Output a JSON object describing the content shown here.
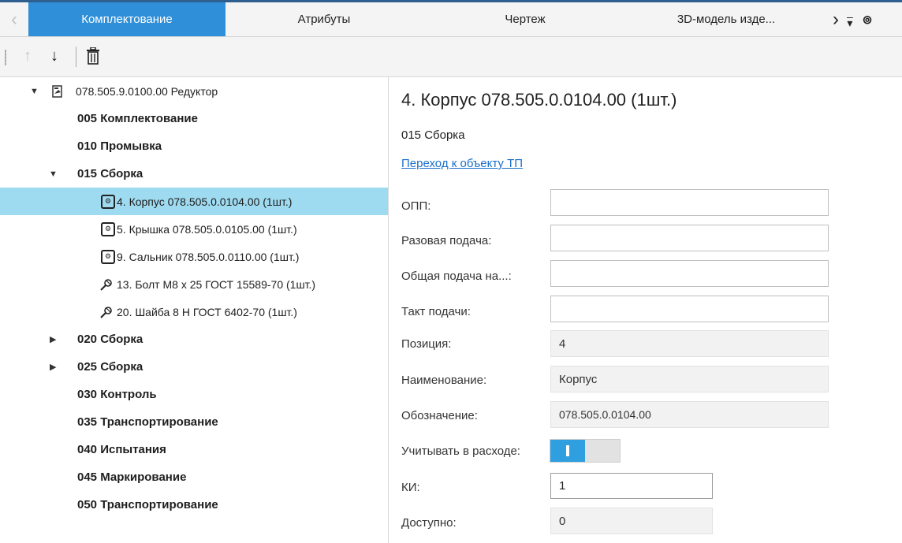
{
  "tabs": {
    "items": [
      {
        "label": "Комплектование",
        "active": true
      },
      {
        "label": "Атрибуты",
        "active": false
      },
      {
        "label": "Чертеж",
        "active": false
      },
      {
        "label": "3D-модель изде...",
        "active": false
      }
    ],
    "prev_icon": "chevron-left-icon",
    "next_icon": "chevron-right-icon",
    "menu_icon": "overflow-menu-icon",
    "accent_color": "#2f8fd8"
  },
  "toolbar": {
    "move_up_icon": "arrow-up-icon",
    "move_down_icon": "arrow-down-icon",
    "delete_icon": "trash-icon"
  },
  "tree": {
    "root": {
      "label": "078.505.9.0100.00 Редуктор",
      "icon": "assembly-icon"
    },
    "op_005": "005 Комплектование",
    "op_010": "010 Промывка",
    "op_015": "015 Сборка",
    "items_015": [
      {
        "label": "4. Корпус 078.505.0.0104.00 (1шт.)",
        "icon": "part-icon",
        "selected": true
      },
      {
        "label": "5. Крышка 078.505.0.0105.00 (1шт.)",
        "icon": "part-icon"
      },
      {
        "label": "9. Сальник 078.505.0.0110.00 (1шт.)",
        "icon": "part-icon"
      },
      {
        "label": "13. Болт М8 х 25 ГОСТ 15589-70 (1шт.)",
        "icon": "standard-part-icon"
      },
      {
        "label": "20. Шайба 8 Н ГОСТ 6402-70 (1шт.)",
        "icon": "standard-part-icon"
      }
    ],
    "op_020": "020 Сборка",
    "op_025": "025 Сборка",
    "op_030": "030 Контроль",
    "op_035": "035 Транспортирование",
    "op_040": "040 Испытания",
    "op_045": "045 Маркирование",
    "op_050": "050 Транспортирование",
    "selected_color": "#9edaf0"
  },
  "detail": {
    "title": "4. Корпус 078.505.0.0104.00 (1шт.)",
    "operation": "015 Сборка",
    "link": "Переход к объекту ТП",
    "fields": {
      "opp": {
        "label": "ОПП:",
        "value": ""
      },
      "single_feed": {
        "label": "Разовая подача:",
        "value": ""
      },
      "total_feed": {
        "label": "Общая подача на...:",
        "value": ""
      },
      "feed_tact": {
        "label": "Такт подачи:",
        "value": ""
      },
      "position": {
        "label": "Позиция:",
        "value": "4"
      },
      "name": {
        "label": "Наименование:",
        "value": "Корпус"
      },
      "designation": {
        "label": "Обозначение:",
        "value": "078.505.0.0104.00"
      },
      "consumption": {
        "label": "Учитывать в расходе:",
        "enabled": true
      },
      "ki": {
        "label": "КИ:",
        "value": "1"
      },
      "available": {
        "label": "Доступно:",
        "value": "0"
      }
    }
  }
}
